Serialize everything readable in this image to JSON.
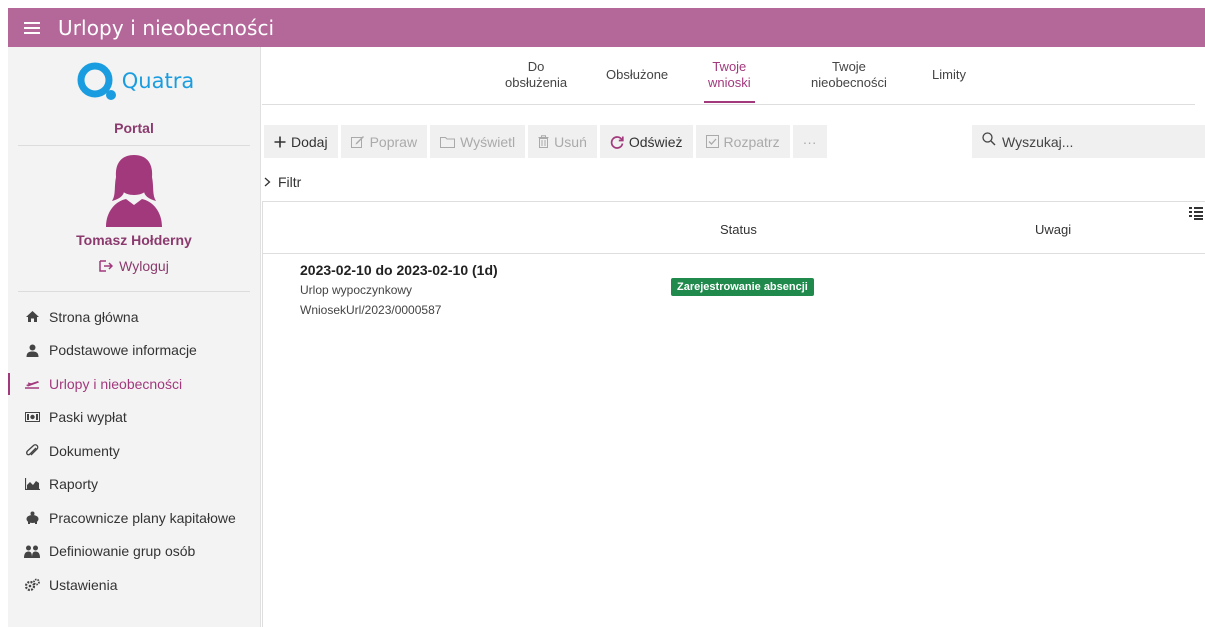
{
  "app": {
    "title": "Urlopy i nieobecności"
  },
  "brand": {
    "logo_text": "Quatra",
    "portal_label": "Portal",
    "accent_color": "#b4689a",
    "link_color": "#a2397d",
    "logo_color": "#1a9de0"
  },
  "user": {
    "name": "Tomasz Hołderny",
    "logout_label": "Wyloguj"
  },
  "nav": {
    "items": [
      {
        "label": "Strona główna",
        "icon": "home-icon"
      },
      {
        "label": "Podstawowe informacje",
        "icon": "user-icon"
      },
      {
        "label": "Urlopy i nieobecności",
        "icon": "plane-icon",
        "active": true
      },
      {
        "label": "Paski wypłat",
        "icon": "money-icon"
      },
      {
        "label": "Dokumenty",
        "icon": "paperclip-icon"
      },
      {
        "label": "Raporty",
        "icon": "chart-icon"
      },
      {
        "label": "Pracownicze plany kapitałowe",
        "icon": "piggy-bank-icon"
      },
      {
        "label": "Definiowanie grup osób",
        "icon": "group-icon"
      },
      {
        "label": "Ustawienia",
        "icon": "gears-icon"
      }
    ]
  },
  "tabs": [
    {
      "line1": "Do",
      "line2": "obsłużenia"
    },
    {
      "line1": "Obsłużone",
      "line2": ""
    },
    {
      "line1": "Twoje",
      "line2": "wnioski",
      "active": true
    },
    {
      "line1": "Twoje",
      "line2": "nieobecności"
    },
    {
      "line1": "Limity",
      "line2": ""
    }
  ],
  "toolbar": {
    "add": "Dodaj",
    "edit": "Popraw",
    "view": "Wyświetl",
    "delete": "Usuń",
    "refresh": "Odśwież",
    "review": "Rozpatrz",
    "more": "···"
  },
  "search": {
    "placeholder": "Wyszukaj..."
  },
  "filter": {
    "label": "Filtr"
  },
  "grid": {
    "columns": {
      "status": "Status",
      "notes": "Uwagi"
    },
    "rows": [
      {
        "title": "2023-02-10 do 2023-02-10 (1d)",
        "type": "Urlop wypoczynkowy",
        "number": "WniosekUrl/2023/0000587",
        "status": "Zarejestrowanie absencji",
        "status_color": "#1f8a4c"
      }
    ]
  }
}
